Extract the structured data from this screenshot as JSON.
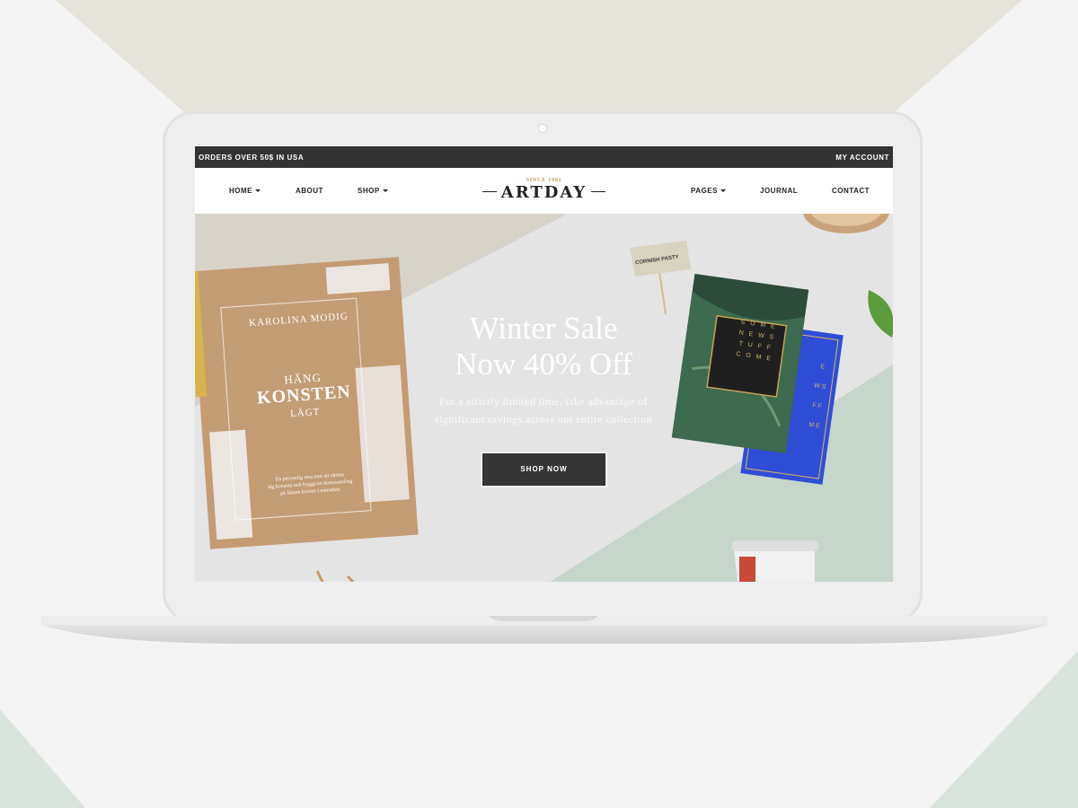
{
  "topbar": {
    "promo": "ORDERS OVER 50$ IN USA",
    "account": "MY ACCOUNT"
  },
  "nav": {
    "left": [
      "HOME",
      "ABOUT",
      "SHOP"
    ],
    "right": [
      "PAGES",
      "JOURNAL",
      "CONTACT"
    ],
    "logo_since": "SINCE 1981",
    "logo": "ARTDAY"
  },
  "hero": {
    "title_line1": "Winter Sale",
    "title_line2": "Now 40% Off",
    "subtitle_line1": "For a strictly limited time, take advantage of",
    "subtitle_line2": "significant savings across our entire collection",
    "cta": "SHOP NOW"
  },
  "book": {
    "author": "KAROLINA MODIG",
    "title_small": "HÄNG",
    "title_big": "KONSTEN",
    "title_sub": "LÄGT",
    "blurb": [
      "En personlig resa mot att närma",
      "sig konsten och bygga en konstsamling",
      "på lättare kronor i månaden."
    ]
  },
  "flag": {
    "text": "CORNISH PASTY"
  },
  "card": {
    "letters": [
      "S O M E",
      "N E W S",
      "T U F F",
      "C O M E"
    ],
    "side": [
      "E",
      "W S",
      "F F",
      "M E"
    ]
  },
  "colors": {
    "topbar": "#333333",
    "accent_gold": "#c7985a",
    "button": "#353535",
    "mint": "#c6d6cb",
    "beige": "#d6d1c5"
  }
}
